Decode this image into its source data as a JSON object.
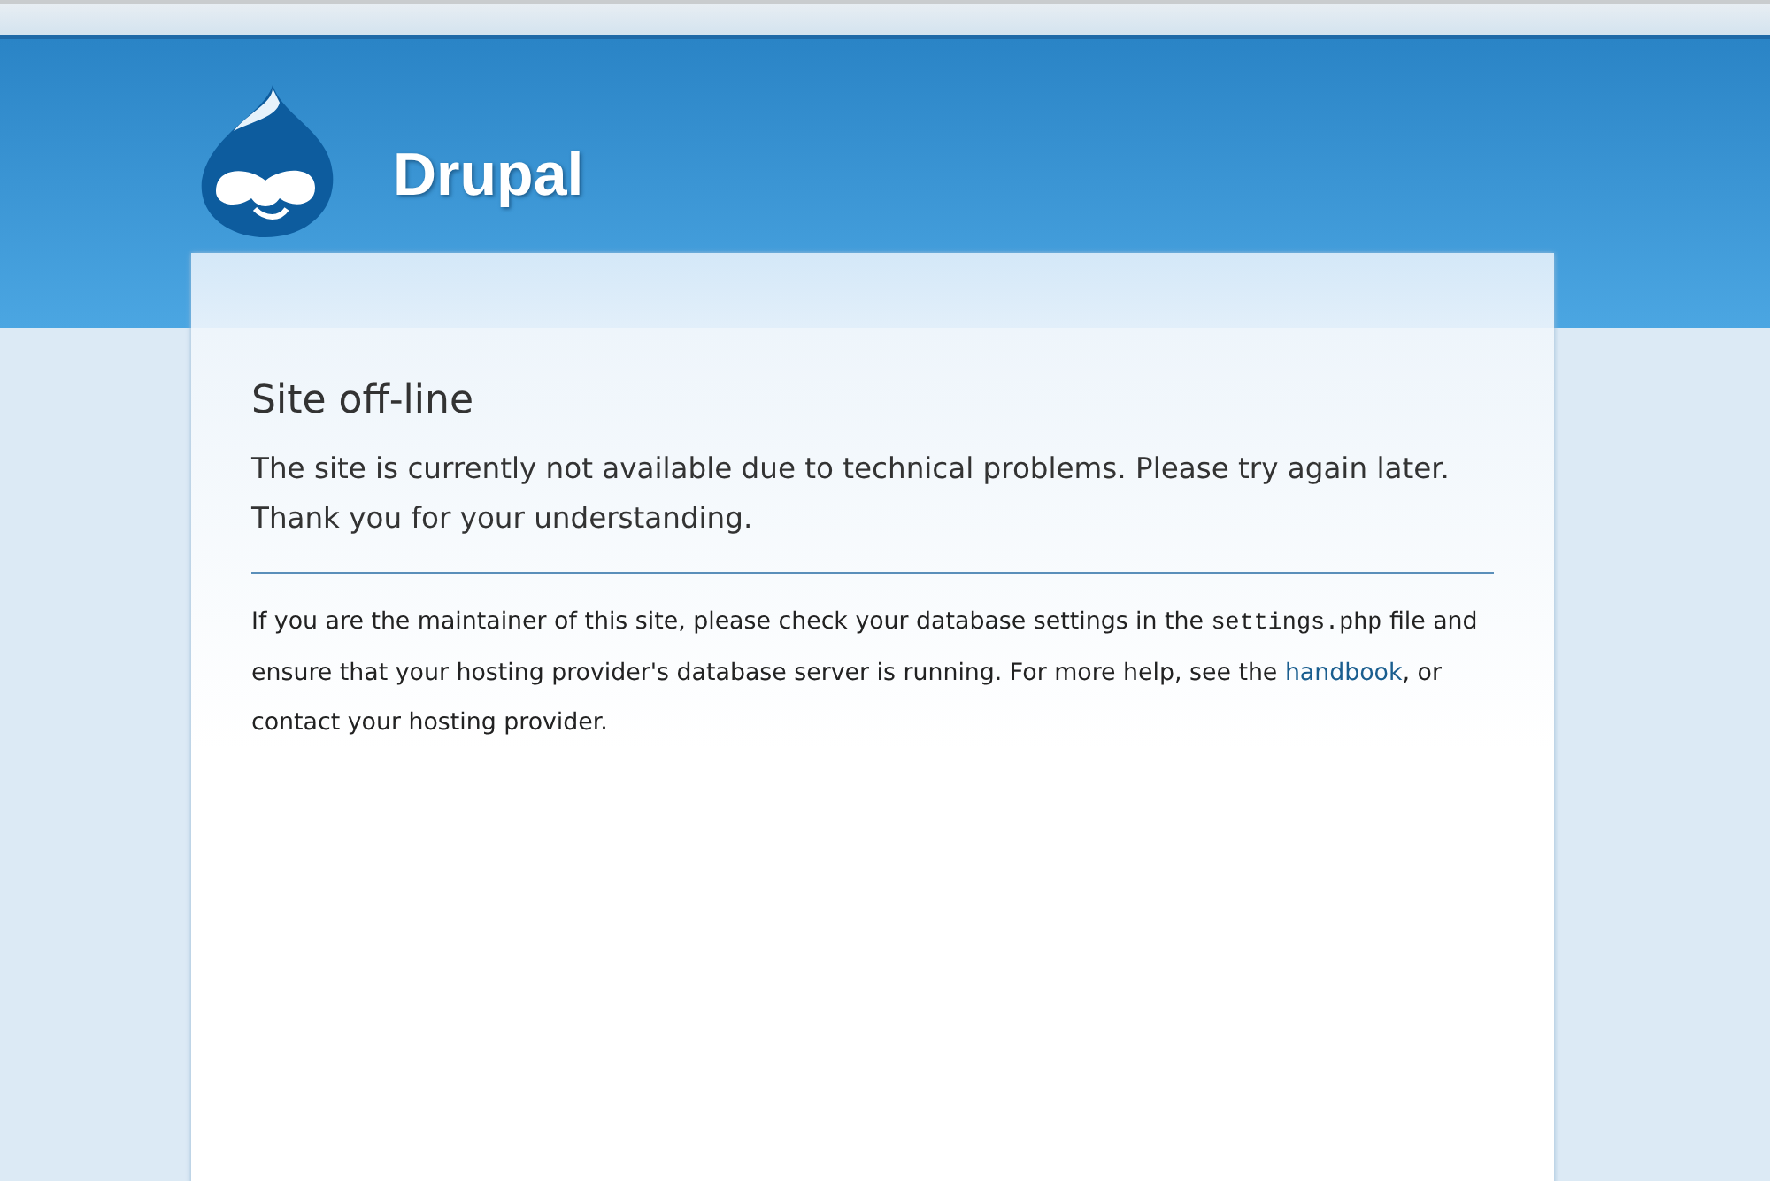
{
  "header": {
    "site_name": "Drupal"
  },
  "content": {
    "title": "Site off-line",
    "message": [
      "The site is currently not available due to technical problems. Please try again later.",
      "Thank you for your understanding."
    ],
    "help": [
      {
        "kind": "text",
        "text": "If you are the maintainer of this site, please check your database settings in the "
      },
      {
        "kind": "code",
        "text": "settings.php"
      },
      {
        "kind": "text",
        "text": " file and ensure that your hosting provider's database server is running. For more help, see the "
      },
      {
        "kind": "link",
        "text": "handbook"
      },
      {
        "kind": "text",
        "text": ", or contact your hosting provider."
      }
    ]
  }
}
